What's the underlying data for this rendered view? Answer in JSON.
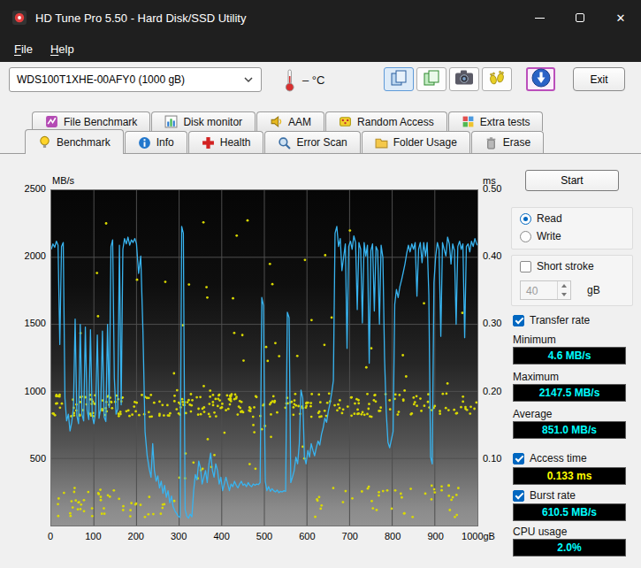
{
  "window": {
    "title": "HD Tune Pro 5.50 - Hard Disk/SSD Utility"
  },
  "menu": {
    "file": "File",
    "help": "Help"
  },
  "toolbar": {
    "drive_select": "WDS100T1XHE-00AFY0 (1000 gB)",
    "temperature": "– °C",
    "exit_label": "Exit"
  },
  "tabs_row1": [
    {
      "label": "File Benchmark",
      "icon": "file-benchmark-icon"
    },
    {
      "label": "Disk monitor",
      "icon": "disk-monitor-icon"
    },
    {
      "label": "AAM",
      "icon": "speaker-icon"
    },
    {
      "label": "Random Access",
      "icon": "dice-icon"
    },
    {
      "label": "Extra tests",
      "icon": "grid-icon"
    }
  ],
  "tabs_row2": [
    {
      "label": "Benchmark",
      "icon": "lightbulb-icon",
      "selected": true
    },
    {
      "label": "Info",
      "icon": "info-icon",
      "selected": false
    },
    {
      "label": "Health",
      "icon": "red-cross-icon",
      "selected": false
    },
    {
      "label": "Error Scan",
      "icon": "magnifier-icon",
      "selected": false
    },
    {
      "label": "Folder Usage",
      "icon": "folder-icon",
      "selected": false
    },
    {
      "label": "Erase",
      "icon": "trash-icon",
      "selected": false
    }
  ],
  "panel": {
    "start_label": "Start",
    "read_label": "Read",
    "write_label": "Write",
    "read_selected": true,
    "short_stroke_label": "Short stroke",
    "short_stroke_checked": false,
    "short_stroke_value": "40",
    "short_stroke_unit": "gB",
    "transfer_rate_label": "Transfer rate",
    "transfer_rate_checked": true,
    "minimum_label": "Minimum",
    "minimum_value": "4.6 MB/s",
    "maximum_label": "Maximum",
    "maximum_value": "2147.5 MB/s",
    "average_label": "Average",
    "average_value": "851.0 MB/s",
    "access_time_label": "Access time",
    "access_time_checked": true,
    "access_time_value": "0.133 ms",
    "burst_rate_label": "Burst rate",
    "burst_rate_checked": true,
    "burst_rate_value": "610.5 MB/s",
    "cpu_usage_label": "CPU usage",
    "cpu_usage_value": "2.0%"
  },
  "chart_data": {
    "type": "line+scatter",
    "x_axis": {
      "unit": "gB",
      "min": 0,
      "max": 1000,
      "tick_values": [
        0,
        100,
        200,
        300,
        400,
        500,
        600,
        700,
        800,
        900,
        1000
      ],
      "tick_labels": [
        "0",
        "100",
        "200",
        "300",
        "400",
        "500",
        "600",
        "700",
        "800",
        "900",
        "1000gB"
      ]
    },
    "y_left": {
      "unit": "MB/s",
      "min": 0,
      "max": 2500,
      "tick_values": [
        2500,
        2000,
        1500,
        1000,
        500
      ],
      "tick_labels": [
        "2500",
        "2000",
        "1500",
        "1000",
        "500"
      ]
    },
    "y_right": {
      "unit": "ms",
      "min": 0,
      "max": 0.5,
      "tick_values": [
        0.5,
        0.4,
        0.3,
        0.2,
        0.1
      ],
      "tick_labels": [
        "0.50",
        "0.40",
        "0.30",
        "0.20",
        "0.10"
      ]
    },
    "transfer_rate": {
      "name": "Transfer rate",
      "unit": "MB/s",
      "color": "#38b4f0",
      "points": [
        [
          0,
          2060
        ],
        [
          4,
          2100
        ],
        [
          8,
          2075
        ],
        [
          12,
          2120
        ],
        [
          16,
          2090
        ],
        [
          20,
          1350
        ],
        [
          24,
          2080
        ],
        [
          28,
          2110
        ],
        [
          32,
          950
        ],
        [
          36,
          780
        ],
        [
          40,
          830
        ],
        [
          44,
          705
        ],
        [
          48,
          770
        ],
        [
          52,
          880
        ],
        [
          56,
          1540
        ],
        [
          60,
          820
        ],
        [
          64,
          760
        ],
        [
          68,
          1500
        ],
        [
          72,
          830
        ],
        [
          76,
          780
        ],
        [
          80,
          1480
        ],
        [
          84,
          860
        ],
        [
          88,
          790
        ],
        [
          92,
          1460
        ],
        [
          96,
          820
        ],
        [
          100,
          760
        ],
        [
          104,
          845
        ],
        [
          108,
          1420
        ],
        [
          112,
          800
        ],
        [
          116,
          870
        ],
        [
          120,
          1450
        ],
        [
          124,
          810
        ],
        [
          128,
          775
        ],
        [
          132,
          1500
        ],
        [
          136,
          880
        ],
        [
          140,
          2080
        ],
        [
          144,
          2130
        ],
        [
          148,
          1100
        ],
        [
          152,
          830
        ],
        [
          156,
          870
        ],
        [
          160,
          2090
        ],
        [
          164,
          900
        ],
        [
          168,
          2060
        ],
        [
          172,
          2140
        ],
        [
          176,
          2100
        ],
        [
          180,
          2150
        ],
        [
          184,
          2090
        ],
        [
          188,
          2130
        ],
        [
          192,
          2110
        ],
        [
          196,
          2140
        ],
        [
          200,
          2100
        ],
        [
          205,
          1880
        ],
        [
          210,
          2010
        ],
        [
          215,
          1450
        ],
        [
          220,
          700
        ],
        [
          225,
          520
        ],
        [
          230,
          420
        ],
        [
          234,
          360
        ],
        [
          238,
          610
        ],
        [
          242,
          410
        ],
        [
          246,
          330
        ],
        [
          250,
          370
        ],
        [
          254,
          280
        ],
        [
          258,
          330
        ],
        [
          262,
          240
        ],
        [
          266,
          300
        ],
        [
          270,
          210
        ],
        [
          274,
          260
        ],
        [
          278,
          170
        ],
        [
          282,
          220
        ],
        [
          286,
          140
        ],
        [
          290,
          110
        ],
        [
          294,
          90
        ],
        [
          298,
          70
        ],
        [
          302,
          60
        ],
        [
          306,
          2230
        ],
        [
          310,
          2180
        ],
        [
          314,
          120
        ],
        [
          318,
          70
        ],
        [
          322,
          55
        ],
        [
          326,
          85
        ],
        [
          330,
          65
        ],
        [
          334,
          260
        ],
        [
          338,
          380
        ],
        [
          342,
          340
        ],
        [
          346,
          480
        ],
        [
          350,
          430
        ],
        [
          354,
          310
        ],
        [
          358,
          360
        ],
        [
          362,
          410
        ],
        [
          366,
          320
        ],
        [
          370,
          460
        ],
        [
          374,
          540
        ],
        [
          378,
          410
        ],
        [
          382,
          360
        ],
        [
          386,
          460
        ],
        [
          390,
          410
        ],
        [
          394,
          310
        ],
        [
          398,
          360
        ],
        [
          402,
          260
        ],
        [
          406,
          310
        ],
        [
          410,
          360
        ],
        [
          414,
          310
        ],
        [
          418,
          260
        ],
        [
          422,
          310
        ],
        [
          426,
          290
        ],
        [
          430,
          330
        ],
        [
          434,
          300
        ],
        [
          438,
          280
        ],
        [
          442,
          310
        ],
        [
          446,
          330
        ],
        [
          450,
          300
        ],
        [
          454,
          310
        ],
        [
          458,
          290
        ],
        [
          462,
          320
        ],
        [
          466,
          300
        ],
        [
          470,
          290
        ],
        [
          474,
          310
        ],
        [
          478,
          300
        ],
        [
          482,
          310
        ],
        [
          486,
          305
        ],
        [
          490,
          320
        ],
        [
          494,
          1700
        ],
        [
          498,
          1640
        ],
        [
          502,
          330
        ],
        [
          506,
          260
        ],
        [
          510,
          290
        ],
        [
          514,
          255
        ],
        [
          518,
          275
        ],
        [
          522,
          260
        ],
        [
          526,
          250
        ],
        [
          530,
          265
        ],
        [
          534,
          245
        ],
        [
          538,
          255
        ],
        [
          542,
          250
        ],
        [
          546,
          260
        ],
        [
          550,
          255
        ],
        [
          554,
          1590
        ],
        [
          558,
          1550
        ],
        [
          562,
          320
        ],
        [
          566,
          360
        ],
        [
          570,
          410
        ],
        [
          574,
          510
        ],
        [
          578,
          460
        ],
        [
          582,
          610
        ],
        [
          586,
          1010
        ],
        [
          590,
          950
        ],
        [
          594,
          510
        ],
        [
          598,
          460
        ],
        [
          602,
          560
        ],
        [
          606,
          510
        ],
        [
          610,
          610
        ],
        [
          614,
          560
        ],
        [
          618,
          520
        ],
        [
          622,
          580
        ],
        [
          626,
          630
        ],
        [
          630,
          600
        ],
        [
          634,
          680
        ],
        [
          638,
          730
        ],
        [
          642,
          800
        ],
        [
          646,
          770
        ],
        [
          650,
          850
        ],
        [
          654,
          910
        ],
        [
          658,
          990
        ],
        [
          662,
          1080
        ],
        [
          666,
          2180
        ],
        [
          670,
          2230
        ],
        [
          674,
          2080
        ],
        [
          678,
          2140
        ],
        [
          682,
          1900
        ],
        [
          686,
          2000
        ],
        [
          690,
          2100
        ],
        [
          694,
          1320
        ],
        [
          698,
          2080
        ],
        [
          702,
          2120
        ],
        [
          706,
          2060
        ],
        [
          710,
          2160
        ],
        [
          714,
          2110
        ],
        [
          718,
          1610
        ],
        [
          722,
          2110
        ],
        [
          726,
          2060
        ],
        [
          730,
          1510
        ],
        [
          734,
          2110
        ],
        [
          738,
          2010
        ],
        [
          742,
          2090
        ],
        [
          746,
          1210
        ],
        [
          750,
          2050
        ],
        [
          754,
          2100
        ],
        [
          758,
          1600
        ],
        [
          762,
          2080
        ],
        [
          766,
          2050
        ],
        [
          770,
          1500
        ],
        [
          774,
          2090
        ],
        [
          778,
          2000
        ],
        [
          782,
          1250
        ],
        [
          786,
          850
        ],
        [
          790,
          620
        ],
        [
          794,
          580
        ],
        [
          798,
          640
        ],
        [
          802,
          700
        ],
        [
          806,
          1650
        ],
        [
          810,
          1760
        ],
        [
          814,
          1700
        ],
        [
          818,
          1780
        ],
        [
          822,
          1830
        ],
        [
          826,
          1890
        ],
        [
          830,
          1950
        ],
        [
          834,
          2030
        ],
        [
          838,
          2090
        ],
        [
          842,
          2040
        ],
        [
          846,
          2100
        ],
        [
          850,
          2060
        ],
        [
          854,
          2110
        ],
        [
          858,
          1710
        ],
        [
          862,
          2060
        ],
        [
          866,
          2110
        ],
        [
          870,
          1960
        ],
        [
          874,
          2110
        ],
        [
          878,
          2010
        ],
        [
          882,
          2110
        ],
        [
          886,
          1720
        ],
        [
          890,
          510
        ],
        [
          894,
          460
        ],
        [
          898,
          1810
        ],
        [
          902,
          2010
        ],
        [
          906,
          2110
        ],
        [
          910,
          2060
        ],
        [
          914,
          1410
        ],
        [
          918,
          2110
        ],
        [
          922,
          2060
        ],
        [
          926,
          2010
        ],
        [
          930,
          2150
        ],
        [
          934,
          2100
        ],
        [
          938,
          1950
        ],
        [
          942,
          2100
        ],
        [
          946,
          2050
        ],
        [
          950,
          1500
        ],
        [
          954,
          2080
        ],
        [
          958,
          2120
        ],
        [
          962,
          2060
        ],
        [
          966,
          2100
        ],
        [
          970,
          1400
        ],
        [
          974,
          2080
        ],
        [
          978,
          2100
        ],
        [
          982,
          2040
        ],
        [
          986,
          2120
        ],
        [
          990,
          2080
        ],
        [
          994,
          2140
        ],
        [
          998,
          2100
        ],
        [
          1000,
          2090
        ]
      ]
    },
    "access_time": {
      "name": "Access time",
      "unit": "ms",
      "color": "#d9d900",
      "bands": [
        {
          "count": 300,
          "x_min": 3,
          "x_max": 1000,
          "ms_min": 0.162,
          "ms_max": 0.197,
          "seed": 11
        },
        {
          "count": 50,
          "x_min": 15,
          "x_max": 290,
          "ms_min": 0.012,
          "ms_max": 0.058,
          "seed": 22
        },
        {
          "count": 45,
          "x_min": 600,
          "x_max": 1000,
          "ms_min": 0.012,
          "ms_max": 0.06,
          "seed": 33
        },
        {
          "count": 28,
          "x_min": 30,
          "x_max": 990,
          "ms_min": 0.2,
          "ms_max": 0.34,
          "seed": 44
        },
        {
          "count": 14,
          "x_min": 50,
          "x_max": 970,
          "ms_min": 0.35,
          "ms_max": 0.47,
          "seed": 55
        },
        {
          "count": 20,
          "x_min": 300,
          "x_max": 600,
          "ms_min": 0.07,
          "ms_max": 0.15,
          "seed": 66
        }
      ]
    }
  }
}
